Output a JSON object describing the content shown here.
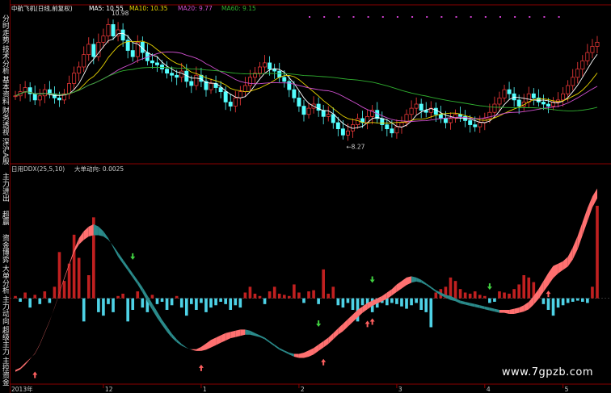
{
  "sidebar": {
    "top_tabs": [
      "分时走势",
      "技术分析",
      "基本资料",
      "财务透视",
      "深沪A股"
    ],
    "bottom_tabs": [
      "主力进出",
      "超赢",
      "资金博弈",
      "大单分析",
      "主力动向",
      "超级主力",
      "主控资金"
    ]
  },
  "header": {
    "stock": "中航飞机(日线,前复权)",
    "ma5": "MA5: 10.55",
    "ma10": "MA10: 10.35",
    "ma20": "MA20: 9.77",
    "ma60": "MA60: 9.15"
  },
  "annotations": {
    "high": "10.98",
    "low": "←8.27"
  },
  "indicator": {
    "label1": "日用DDX(25,5,10)",
    "label2": "大单动向: 0.0025"
  },
  "xaxis": {
    "year_label": "2013年",
    "months": [
      "12",
      "1",
      "2",
      "3",
      "4",
      "5"
    ]
  },
  "watermark": "www.7gpzb.com",
  "colors": {
    "up": "#ff3c3c",
    "down": "#54ffff",
    "ma5": "#ffffff",
    "ma10": "#e6d200",
    "ma20": "#d050d0",
    "ma60": "#30b030",
    "band_up": "#ff7070",
    "band_down": "#2a8a8a",
    "bar_pos": "#c02020",
    "bar_neg": "#4ed2e6",
    "dash_marks": "#d040d0",
    "arrow_up": "#ff6060",
    "arrow_down": "#40d040"
  },
  "chart_data": {
    "type": "line",
    "n": 120,
    "price_ylim": [
      7.7,
      11.3
    ],
    "closes": [
      9.25,
      9.35,
      9.45,
      9.3,
      9.15,
      9.25,
      9.4,
      9.3,
      9.2,
      9.15,
      9.3,
      9.55,
      9.8,
      9.95,
      10.25,
      10.5,
      10.2,
      10.55,
      10.7,
      10.98,
      10.7,
      10.85,
      10.6,
      10.35,
      10.2,
      10.55,
      10.3,
      10.1,
      10.05,
      10.0,
      9.9,
      9.8,
      9.75,
      9.7,
      9.85,
      9.6,
      9.5,
      9.75,
      9.6,
      9.4,
      9.55,
      9.45,
      9.35,
      9.1,
      9.0,
      9.2,
      9.35,
      9.5,
      9.7,
      9.8,
      9.95,
      10.05,
      9.9,
      9.85,
      9.7,
      9.6,
      9.4,
      9.2,
      9.0,
      8.8,
      8.95,
      9.05,
      8.9,
      8.75,
      8.8,
      8.6,
      8.45,
      8.3,
      8.4,
      8.55,
      8.7,
      8.6,
      8.75,
      8.9,
      8.7,
      8.55,
      8.45,
      8.35,
      8.5,
      8.6,
      8.8,
      8.95,
      9.05,
      8.9,
      8.85,
      8.95,
      8.8,
      8.7,
      8.6,
      8.7,
      8.8,
      8.75,
      8.65,
      8.55,
      8.5,
      8.6,
      8.7,
      8.85,
      9.05,
      9.2,
      9.4,
      9.3,
      9.15,
      9.0,
      9.1,
      9.3,
      9.2,
      9.1,
      9.05,
      9.0,
      9.1,
      9.15,
      9.3,
      9.5,
      9.7,
      9.9,
      10.1,
      10.3,
      10.45,
      10.55
    ],
    "ddx_ylim": [
      -0.7,
      1.1
    ],
    "ddx_bars": [
      0.02,
      -0.03,
      0.05,
      -0.08,
      0.03,
      -0.05,
      0.06,
      -0.04,
      0.1,
      0.4,
      0.15,
      0.3,
      0.55,
      0.35,
      -0.2,
      0.2,
      0.7,
      -0.12,
      -0.15,
      -0.05,
      -0.12,
      0.02,
      0.04,
      -0.2,
      -0.1,
      0.06,
      -0.08,
      -0.12,
      0.03,
      -0.05,
      -0.03,
      -0.1,
      -0.06,
      0.02,
      -0.08,
      -0.15,
      -0.05,
      -0.1,
      -0.04,
      -0.12,
      -0.08,
      -0.06,
      -0.03,
      -0.05,
      -0.1,
      -0.06,
      -0.08,
      0.05,
      0.1,
      0.04,
      0.02,
      -0.05,
      0.06,
      0.1,
      0.04,
      0.03,
      0.02,
      0.12,
      0.05,
      -0.04,
      0.06,
      0.07,
      -0.05,
      0.25,
      0.04,
      0.1,
      -0.06,
      -0.08,
      -0.04,
      -0.1,
      -0.2,
      -0.06,
      -0.05,
      -0.12,
      -0.08,
      -0.04,
      -0.06,
      -0.04,
      -0.05,
      -0.07,
      -0.09,
      -0.06,
      -0.04,
      -0.1,
      -0.12,
      -0.25,
      0.05,
      0.08,
      0.1,
      0.18,
      0.15,
      0.08,
      0.05,
      0.04,
      0.06,
      0.03,
      0.02,
      -0.04,
      -0.03,
      0.06,
      0.05,
      0.04,
      0.08,
      0.12,
      0.2,
      0.18,
      0.14,
      0.06,
      -0.05,
      -0.1,
      -0.15,
      -0.08,
      -0.06,
      -0.04,
      -0.03,
      -0.02,
      -0.03,
      -0.04,
      0.1,
      0.8
    ],
    "ddx_line": [
      -0.62,
      -0.6,
      -0.56,
      -0.52,
      -0.48,
      -0.4,
      -0.3,
      -0.2,
      -0.08,
      0.05,
      0.18,
      0.3,
      0.42,
      0.52,
      0.58,
      0.62,
      0.64,
      0.62,
      0.58,
      0.52,
      0.44,
      0.36,
      0.3,
      0.24,
      0.18,
      0.12,
      0.05,
      -0.03,
      -0.1,
      -0.17,
      -0.23,
      -0.29,
      -0.34,
      -0.38,
      -0.41,
      -0.43,
      -0.44,
      -0.44,
      -0.42,
      -0.39,
      -0.36,
      -0.34,
      -0.32,
      -0.3,
      -0.29,
      -0.28,
      -0.27,
      -0.27,
      -0.28,
      -0.3,
      -0.32,
      -0.34,
      -0.37,
      -0.4,
      -0.43,
      -0.45,
      -0.47,
      -0.48,
      -0.48,
      -0.47,
      -0.45,
      -0.43,
      -0.4,
      -0.37,
      -0.34,
      -0.3,
      -0.26,
      -0.22,
      -0.18,
      -0.14,
      -0.1,
      -0.07,
      -0.04,
      -0.02,
      0.0,
      0.02,
      0.05,
      0.08,
      0.12,
      0.15,
      0.18,
      0.19,
      0.18,
      0.16,
      0.13,
      0.1,
      0.07,
      0.05,
      0.03,
      0.02,
      0.0,
      -0.02,
      -0.03,
      -0.04,
      -0.05,
      -0.06,
      -0.07,
      -0.08,
      -0.09,
      -0.1,
      -0.1,
      -0.1,
      -0.09,
      -0.08,
      -0.06,
      -0.03,
      0.02,
      0.08,
      0.15,
      0.22,
      0.28,
      0.3,
      0.32,
      0.36,
      0.44,
      0.54,
      0.66,
      0.78,
      0.88,
      0.95
    ],
    "ddx_line2": [
      -0.6,
      -0.58,
      -0.54,
      -0.49,
      -0.44,
      -0.36,
      -0.26,
      -0.16,
      -0.05,
      0.08,
      0.2,
      0.32,
      0.43,
      0.5,
      0.54,
      0.57,
      0.58,
      0.58,
      0.57,
      0.54,
      0.49,
      0.43,
      0.37,
      0.31,
      0.25,
      0.19,
      0.13,
      0.06,
      -0.01,
      -0.08,
      -0.15,
      -0.21,
      -0.27,
      -0.32,
      -0.36,
      -0.39,
      -0.41,
      -0.42,
      -0.42,
      -0.41,
      -0.39,
      -0.37,
      -0.35,
      -0.33,
      -0.31,
      -0.3,
      -0.29,
      -0.28,
      -0.28,
      -0.29,
      -0.3,
      -0.32,
      -0.35,
      -0.38,
      -0.41,
      -0.43,
      -0.45,
      -0.47,
      -0.48,
      -0.48,
      -0.47,
      -0.45,
      -0.42,
      -0.39,
      -0.36,
      -0.32,
      -0.28,
      -0.25,
      -0.21,
      -0.17,
      -0.13,
      -0.09,
      -0.06,
      -0.03,
      -0.01,
      0.01,
      0.03,
      0.06,
      0.09,
      0.12,
      0.15,
      0.17,
      0.18,
      0.17,
      0.15,
      0.12,
      0.09,
      0.06,
      0.04,
      0.02,
      0.01,
      -0.01,
      -0.02,
      -0.03,
      -0.04,
      -0.05,
      -0.06,
      -0.07,
      -0.08,
      -0.09,
      -0.09,
      -0.1,
      -0.1,
      -0.09,
      -0.08,
      -0.06,
      -0.02,
      0.03,
      0.09,
      0.15,
      0.21,
      0.25,
      0.28,
      0.31,
      0.37,
      0.46,
      0.58,
      0.7,
      0.82,
      0.9
    ],
    "up_arrows": [
      4,
      38,
      63,
      72,
      73,
      109
    ],
    "down_arrows": [
      24,
      62,
      73,
      97
    ]
  }
}
